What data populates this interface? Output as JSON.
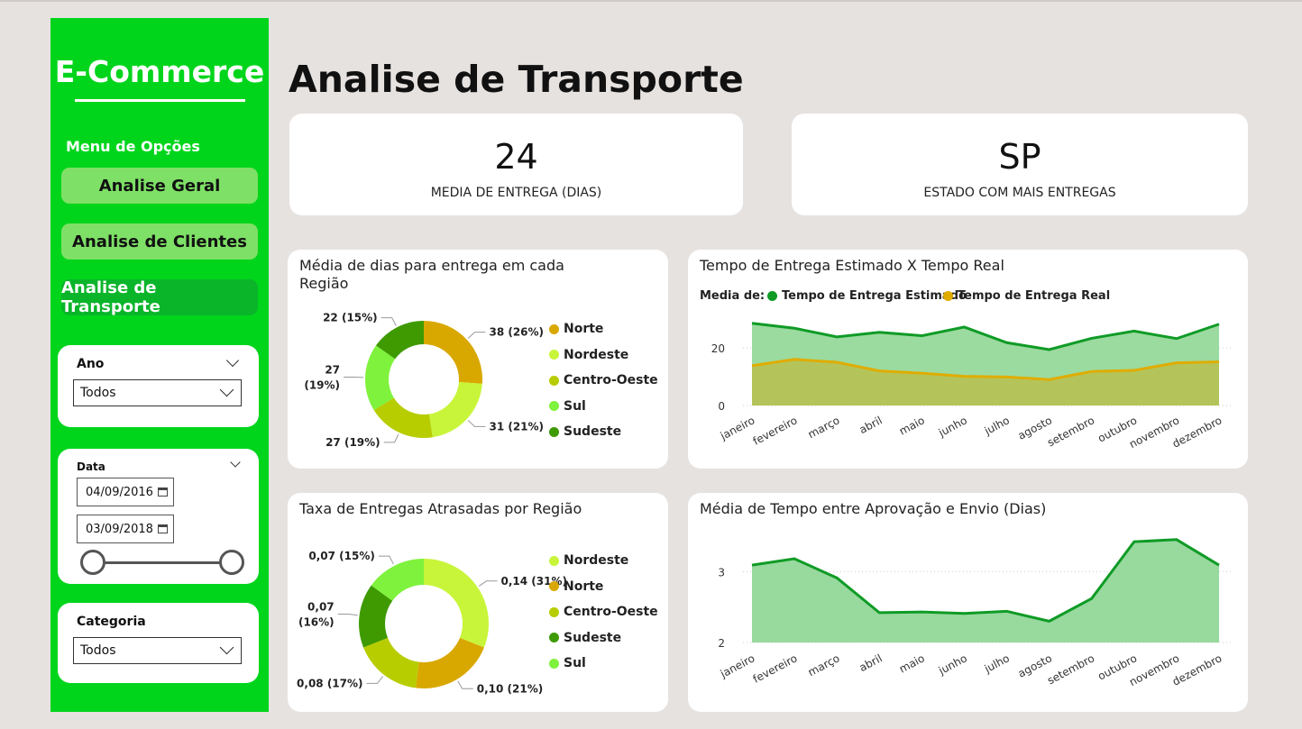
{
  "sidebar": {
    "brand": "E-Commerce",
    "menu_title": "Menu de Opções",
    "buttons": [
      "Analise Geral",
      "Analise de Clientes",
      "Analise de Transporte"
    ],
    "active_button": "Analise de Transporte",
    "filters": {
      "ano": {
        "label": "Ano",
        "value": "Todos"
      },
      "data": {
        "label": "Data",
        "start": "04/09/2016",
        "end": "03/09/2018"
      },
      "categoria": {
        "label": "Categoria",
        "value": "Todos"
      }
    },
    "icons": [
      "chevron-down-icon",
      "calendar-icon"
    ]
  },
  "page_title": "Analise de Transporte",
  "kpis": [
    {
      "value": "24",
      "label": "MEDIA DE ENTREGA (DIAS)"
    },
    {
      "value": "SP",
      "label": "ESTADO COM MAIS ENTREGAS"
    }
  ],
  "colors": {
    "sidebar": "#00d51c",
    "active_button": "#0ab52a",
    "button": "#7ee066",
    "estimado": "#0f9b26",
    "real": "#e0ac00"
  },
  "chart_data": [
    {
      "type": "pie",
      "title": "Média de dias para entrega em cada Região",
      "slices": [
        {
          "name": "Norte",
          "value": 38,
          "label": "38 (26%)",
          "color": "#d9a800"
        },
        {
          "name": "Nordeste",
          "value": 31,
          "label": "31 (21%)",
          "color": "#c8f53a"
        },
        {
          "name": "Centro-Oeste",
          "value": 27,
          "label": "27 (19%)",
          "color": "#b7cd00"
        },
        {
          "name": "Sul",
          "value": 27,
          "label": "27\n(19%)",
          "color": "#7ef23c"
        },
        {
          "name": "Sudeste",
          "value": 22,
          "label": "22 (15%)",
          "color": "#3e9a00"
        }
      ]
    },
    {
      "type": "area",
      "title": "Tempo de Entrega Estimado X Tempo Real",
      "legend_prefix": "Media de:",
      "categories": [
        "janeiro",
        "fevereiro",
        "março",
        "abril",
        "maio",
        "junho",
        "julho",
        "agosto",
        "setembro",
        "outubro",
        "novembro",
        "dezembro"
      ],
      "series": [
        {
          "name": "Tempo de Entrega Estimado",
          "values": [
            28.5,
            26.8,
            23.8,
            25.4,
            24.2,
            27.2,
            21.8,
            19.4,
            23.3,
            25.8,
            23.2,
            28.2
          ],
          "color": "#0f9b26"
        },
        {
          "name": "Tempo de Entrega Real",
          "values": [
            13.8,
            16.0,
            15.0,
            12.0,
            11.2,
            10.1,
            9.9,
            9.0,
            11.8,
            12.2,
            14.8,
            15.1
          ],
          "color": "#e0ac00"
        }
      ],
      "ylim": [
        0,
        30
      ],
      "yticks": [
        "0",
        "20"
      ]
    },
    {
      "type": "pie",
      "title": "Taxa de Entregas Atrasadas por Região",
      "slices": [
        {
          "name": "Nordeste",
          "value": 0.14,
          "label": "0,14 (31%)",
          "color": "#c8f53a"
        },
        {
          "name": "Norte",
          "value": 0.1,
          "label": "0,10 (21%)",
          "color": "#d9a800"
        },
        {
          "name": "Centro-Oeste",
          "value": 0.08,
          "label": "0,08 (17%)",
          "color": "#b7cd00"
        },
        {
          "name": "Sudeste",
          "value": 0.07,
          "label": "0,07\n(16%)",
          "color": "#3e9a00"
        },
        {
          "name": "Sul",
          "value": 0.07,
          "label": "0,07 (15%)",
          "color": "#7ef23c"
        }
      ],
      "weights": [
        31,
        21,
        17,
        16,
        15
      ]
    },
    {
      "type": "area",
      "title": "Média de Tempo entre Aprovação e Envio (Dias)",
      "categories": [
        "janeiro",
        "fevereiro",
        "março",
        "abril",
        "maio",
        "junho",
        "julho",
        "agosto",
        "setembro",
        "outubro",
        "novembro",
        "dezembro"
      ],
      "series": [
        {
          "values": [
            3.09,
            3.18,
            2.91,
            2.42,
            2.43,
            2.41,
            2.44,
            2.3,
            2.62,
            3.42,
            3.45,
            3.09
          ],
          "color": "#0f9b26"
        }
      ],
      "ylim": [
        2.0,
        3.6
      ],
      "yticks": [
        "2",
        "3"
      ]
    }
  ]
}
